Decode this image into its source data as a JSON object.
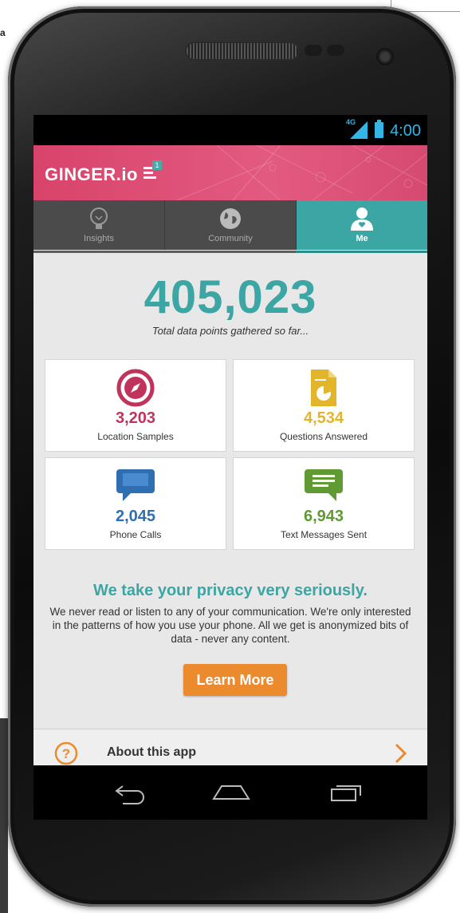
{
  "status_bar": {
    "network": "4G",
    "time": "4:00"
  },
  "header": {
    "logo": "GINGER.io",
    "menu_badge": "1"
  },
  "tabs": [
    {
      "label": "Insights",
      "icon": "lightbulb-icon",
      "active": false
    },
    {
      "label": "Community",
      "icon": "globe-icon",
      "active": false
    },
    {
      "label": "Me",
      "icon": "person-icon",
      "active": true
    }
  ],
  "summary": {
    "total": "405,023",
    "caption": "Total data points gathered so far..."
  },
  "stats": [
    {
      "value": "3,203",
      "label": "Location Samples",
      "icon": "compass-icon",
      "color": "#c0335a"
    },
    {
      "value": "4,534",
      "label": "Questions Answered",
      "icon": "document-pie-icon",
      "color": "#e3b52b"
    },
    {
      "value": "2,045",
      "label": "Phone Calls",
      "icon": "speech-bubble-icon",
      "color": "#2f6fb1"
    },
    {
      "value": "6,943",
      "label": "Text Messages Sent",
      "icon": "message-icon",
      "color": "#5f9a32"
    }
  ],
  "privacy": {
    "title": "We take your privacy very seriously.",
    "body": "We never read or listen to any of your communication. We're only interested in the patterns of how you use your phone.  All we get is anonymized bits of data - never any content."
  },
  "learn_more_label": "Learn More",
  "about": {
    "label": "About this app"
  },
  "colors": {
    "accent": "#3ba6a3",
    "header": "#d8436b",
    "button": "#ec8a2e"
  }
}
